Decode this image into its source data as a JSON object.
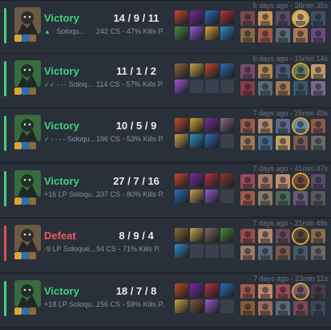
{
  "colors": {
    "win": "#3fd17a",
    "loss": "#ef5a62",
    "bg": "#232830",
    "row": "#2a3039",
    "highlight": "#d7a831"
  },
  "matches": [
    {
      "result": "Victory",
      "outcome": "win",
      "queue_text": "Soloqu...",
      "lp_text": "",
      "checks": "▲ ·",
      "kda": "14 / 9 / 11",
      "cs_text": "242 CS - 47% Kills P.",
      "time": "6 days ago - 38min 35s",
      "champ_color": "#6b5b45",
      "items": [
        "#c24a2a",
        "#7b2b9c",
        "#2c6db7",
        "#b8323a",
        "#4a8a3e",
        "#9a5ad0",
        "#d9a332",
        "#2f8fc4",
        "#7a5a3a"
      ],
      "team": [
        "#7a4a4a",
        "#c7965a",
        "#5a4a6a",
        "#d4b07a",
        "#3f4f66",
        "#8a6a4a",
        "#a85a4a",
        "#5d6c7a",
        "#b07a5a",
        "#6a4a7a"
      ]
    },
    {
      "result": "Victory",
      "outcome": "win",
      "queue_text": "Soloq...",
      "lp_text": "",
      "checks": "✓✓ - - -",
      "kda": "11 / 1 / 2",
      "cs_text": "114 CS - 57% Kills P.",
      "time": "6 days ago - 15min 14s",
      "champ_color": "#3a6b3e",
      "items": [
        "#8a6a3a",
        "#caa24a",
        "#c24a2a",
        "#2c6db7",
        "#9a5ad0",
        "",
        "",
        "",
        ""
      ],
      "team": [
        "#7a4a6a",
        "#b08a5a",
        "#4a5a7a",
        "#6a7a5a",
        "#c09a6a",
        "#8a3a4a",
        "#5a6a7a",
        "#a07a5a",
        "#3a5a6a",
        "#7a6a8a"
      ]
    },
    {
      "result": "Victory",
      "outcome": "win",
      "queue_text": "Soloqu...",
      "lp_text": "",
      "checks": "✓ - - - -",
      "kda": "10 / 5 / 9",
      "cs_text": "196 CS - 53% Kills P.",
      "time": "7 days ago - 25min 40s",
      "champ_color": "#3a6b3e",
      "items": [
        "#c24a2a",
        "#d9a332",
        "#7b2b9c",
        "#8a6a8a",
        "#caa24a",
        "#2f8fc4",
        "#2c6db7",
        "",
        ""
      ],
      "team": [
        "#9a5a4a",
        "#b08a6a",
        "#5a6a8a",
        "#6a8aaa",
        "#8a5a4a",
        "#a07a5a",
        "#4a6a8a",
        "#c0a06a",
        "#7a5a5a",
        "#6a6a6a"
      ]
    },
    {
      "result": "Victory",
      "outcome": "win",
      "queue_text": "",
      "lp_text": "+16 LP Soloqu...",
      "checks": "",
      "kda": "27 / 7 / 16",
      "cs_text": "337 CS - 80% Kills P.",
      "time": "7 days ago - 41min 47s",
      "champ_color": "#3a6b3e",
      "items": [
        "#c24a2a",
        "#7b2b9c",
        "#b8323a",
        "#8a3a2a",
        "#2c6db7",
        "#caa24a",
        "#9a5ad0",
        "",
        ""
      ],
      "team": [
        "#9a4a5a",
        "#b07a6a",
        "#c09070",
        "#7a4a3a",
        "#5a4a6a",
        "#a05a4a",
        "#8a7a6a",
        "#4a6a5a",
        "#6a5a7a",
        "#5a5a5a"
      ]
    },
    {
      "result": "Defeat",
      "outcome": "loss",
      "queue_text": "",
      "lp_text": "-9 LP Soloque...",
      "checks": "",
      "kda": "8 / 9 / 4",
      "cs_text": "94 CS - 71% Kills P.",
      "time": "7 days ago - 21min 48s",
      "champ_color": "#6b5b45",
      "items": [
        "#8a6a3a",
        "#caa24a",
        "#7a6a5a",
        "#4a8a3e",
        "#2f8fc4",
        "",
        "",
        "",
        ""
      ],
      "team": [
        "#9a4a4a",
        "#b08a6a",
        "#6a4a5a",
        "#5a4a3a",
        "#8a6a4a",
        "#a07a6a",
        "#5a6a7a",
        "#7a5a4a",
        "#4a5a6a",
        "#6a6a6a"
      ]
    },
    {
      "result": "Victory",
      "outcome": "win",
      "queue_text": "",
      "lp_text": "+18 LP Soloqu...",
      "checks": "",
      "kda": "18 / 7 / 8",
      "cs_text": "156 CS - 59% Kills P.",
      "time": "7 days ago - 23min 11s",
      "champ_color": "#3a6b3e",
      "items": [
        "#c24a2a",
        "#7b2b9c",
        "#b8323a",
        "#2c6db7",
        "#caa24a",
        "#7a5a3a",
        "#9a5ad0",
        "",
        ""
      ],
      "team": [
        "#a05a4a",
        "#c08a6a",
        "#9a4a5a",
        "#7a5a6a",
        "#4a3a4a",
        "#8a5a3a",
        "#a06a5a",
        "#5a6a7a",
        "#7a4a5a",
        "#3a4a5a"
      ]
    }
  ]
}
